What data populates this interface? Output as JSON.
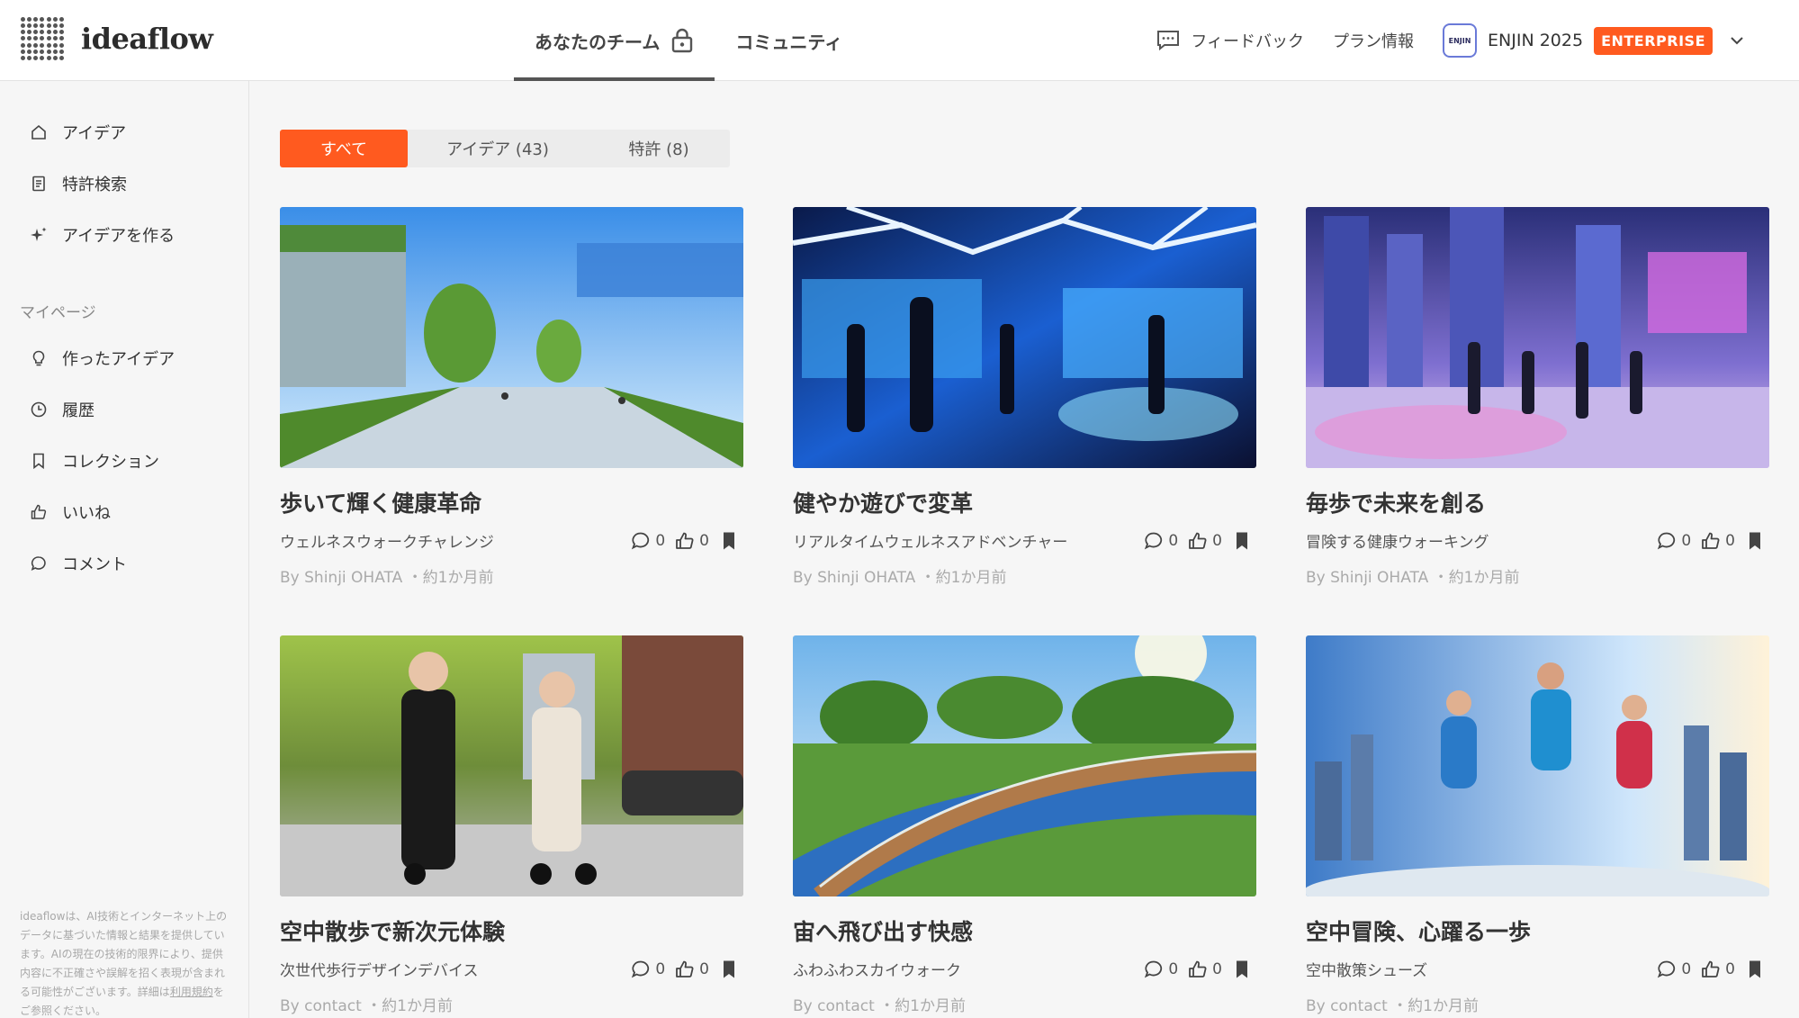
{
  "header": {
    "logo_text": "ideaflow",
    "tabs": [
      {
        "label": "あなたのチーム",
        "active": true
      },
      {
        "label": "コミュニティ",
        "active": false
      }
    ],
    "feedback_label": "フィードバック",
    "plan_label": "プラン情報",
    "team_avatar_text": "ENJIN",
    "team_name": "ENJIN 2025",
    "plan_badge": "ENTERPRISE",
    "accent_color": "#ff5a1f"
  },
  "sidebar": {
    "items": [
      {
        "label": "アイデア",
        "icon": "home-icon"
      },
      {
        "label": "特許検索",
        "icon": "document-icon"
      },
      {
        "label": "アイデアを作る",
        "icon": "sparkle-icon"
      }
    ],
    "section_title": "マイページ",
    "mypage_items": [
      {
        "label": "作ったアイデア",
        "icon": "lightbulb-icon"
      },
      {
        "label": "履歴",
        "icon": "clock-icon"
      },
      {
        "label": "コレクション",
        "icon": "bookmark-icon"
      },
      {
        "label": "いいね",
        "icon": "thumbs-up-icon"
      },
      {
        "label": "コメント",
        "icon": "comment-icon"
      }
    ],
    "footer_text": "ideaflowは、AI技術とインターネット上のデータに基づいた情報と結果を提供しています。AIの現在の技術的限界により、提供内容に不正確さや誤解を招く表現が含まれる可能性がございます。詳細は",
    "footer_link": "利用規約",
    "footer_suffix": "をご参照ください。"
  },
  "filters": [
    {
      "label": "すべて",
      "active": true
    },
    {
      "label": "アイデア (43)",
      "active": false
    },
    {
      "label": "特許 (8)",
      "active": false
    }
  ],
  "cards": [
    {
      "title": "歩いて輝く健康革命",
      "subtitle": "ウェルネスウォークチャレンジ",
      "comments": "0",
      "likes": "0",
      "author": "By Shinji OHATA",
      "time": "・約1か月前"
    },
    {
      "title": "健やか遊びで変革",
      "subtitle": "リアルタイムウェルネスアドベンチャー",
      "comments": "0",
      "likes": "0",
      "author": "By Shinji OHATA",
      "time": "・約1か月前"
    },
    {
      "title": "毎歩で未来を創る",
      "subtitle": "冒険する健康ウォーキング",
      "comments": "0",
      "likes": "0",
      "author": "By Shinji OHATA",
      "time": "・約1か月前"
    },
    {
      "title": "空中散歩で新次元体験",
      "subtitle": "次世代歩行デザインデバイス",
      "comments": "0",
      "likes": "0",
      "author": "By contact",
      "time": "・約1か月前"
    },
    {
      "title": "宙へ飛び出す快感",
      "subtitle": "ふわふわスカイウォーク",
      "comments": "0",
      "likes": "0",
      "author": "By contact",
      "time": "・約1か月前"
    },
    {
      "title": "空中冒険、心躍る一歩",
      "subtitle": "空中散策シューズ",
      "comments": "0",
      "likes": "0",
      "author": "By contact",
      "time": "・約1か月前"
    }
  ]
}
